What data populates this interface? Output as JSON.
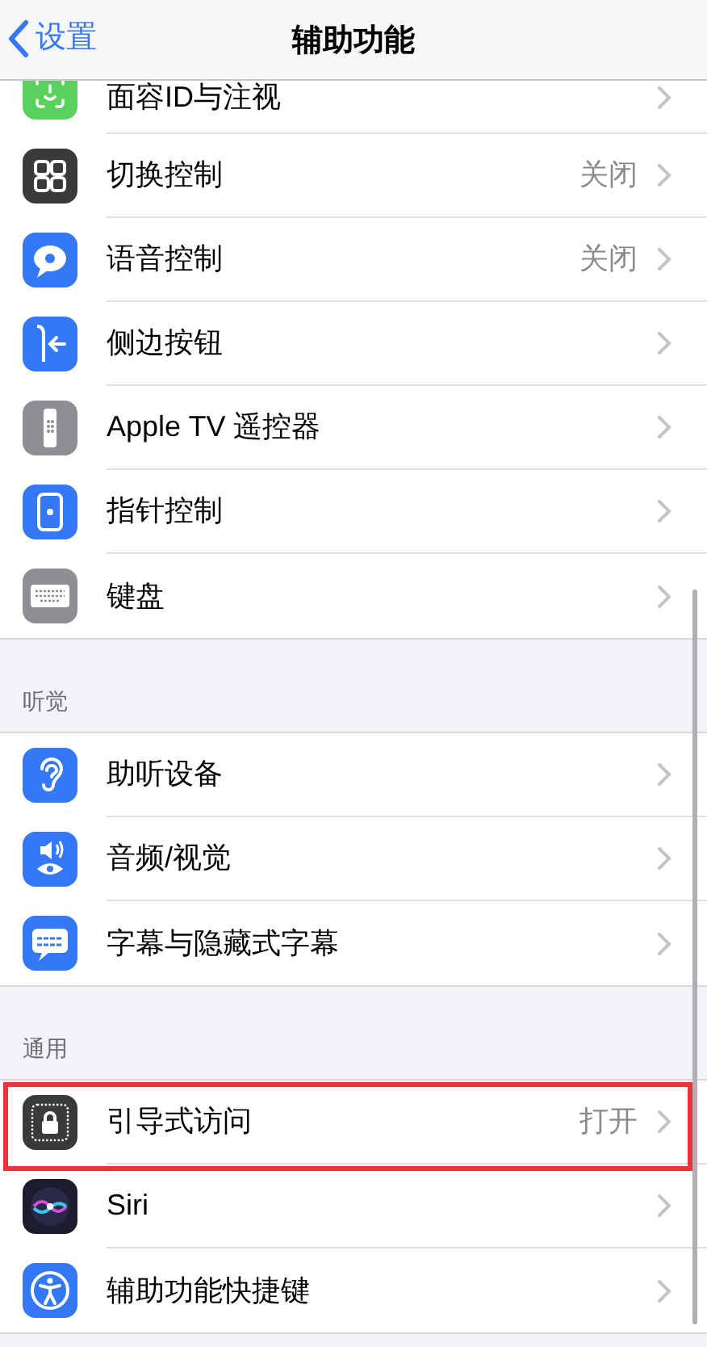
{
  "nav": {
    "back": "设置",
    "title": "辅助功能"
  },
  "sections": [
    {
      "rows": [
        {
          "label": "面容ID与注视",
          "highlighted": false
        },
        {
          "label": "切换控制",
          "value": "关闭",
          "highlighted": false
        },
        {
          "label": "语音控制",
          "value": "关闭",
          "highlighted": false
        },
        {
          "label": "侧边按钮",
          "highlighted": false
        },
        {
          "label": "Apple TV 遥控器",
          "highlighted": false
        },
        {
          "label": "指针控制",
          "highlighted": false
        },
        {
          "label": "键盘",
          "highlighted": false
        }
      ]
    },
    {
      "header": "听觉",
      "rows": [
        {
          "label": "助听设备",
          "highlighted": false
        },
        {
          "label": "音频/视觉",
          "highlighted": false
        },
        {
          "label": "字幕与隐藏式字幕",
          "highlighted": false
        }
      ]
    },
    {
      "header": "通用",
      "rows": [
        {
          "label": "引导式访问",
          "value": "打开",
          "highlighted": true
        },
        {
          "label": "Siri",
          "highlighted": false
        },
        {
          "label": "辅助功能快捷键",
          "highlighted": false
        }
      ]
    }
  ]
}
